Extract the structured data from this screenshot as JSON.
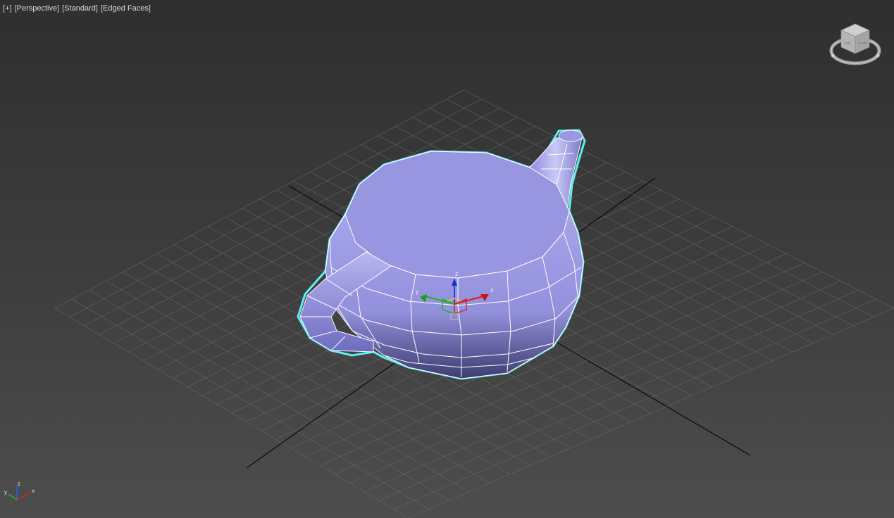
{
  "viewport": {
    "labels": {
      "plus": "+",
      "view": "Perspective",
      "shading": "Standard",
      "edges": "Edged Faces"
    },
    "background_top": "#2f2f2f",
    "background_bottom": "#4d4d4d"
  },
  "colors": {
    "mesh_fill": "#9a98e0",
    "mesh_dark": "#5f5ea8",
    "selection_outline": "#5ef0f0",
    "grid_line": "#6a6a6a",
    "axis_x": "#d42020",
    "axis_y": "#20b020",
    "axis_z": "#2040e0"
  },
  "gizmo": {
    "x_label": "x",
    "y_label": "y",
    "z_label": "z"
  },
  "viewcube": {
    "icon": "viewcube-icon",
    "front_label": "Front",
    "left_label": "Left"
  },
  "axis_tripod": {
    "icon": "axis-tripod-icon",
    "x_label": "x",
    "y_label": "y",
    "z_label": "z"
  }
}
